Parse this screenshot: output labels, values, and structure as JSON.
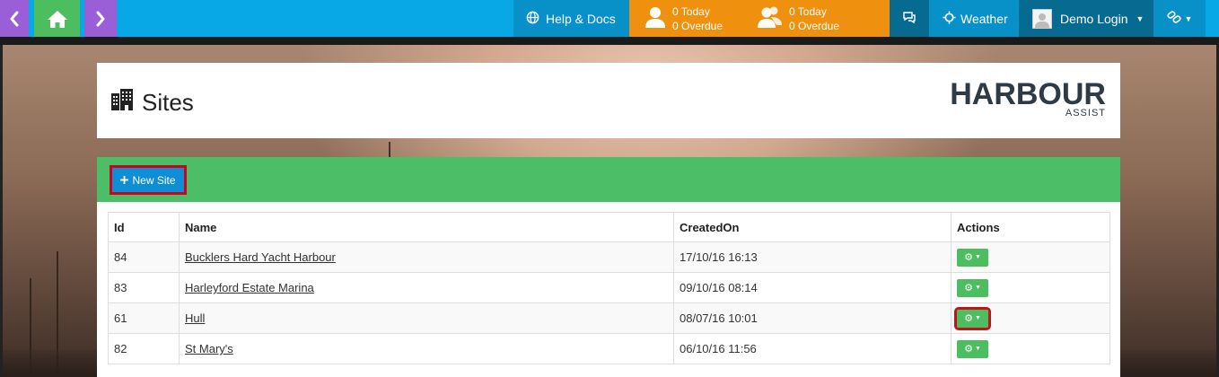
{
  "nav": {
    "back_icon": "chevron-left-icon",
    "home_icon": "home-icon",
    "forward_icon": "chevron-right-icon"
  },
  "topbar": {
    "help_label": "Help & Docs",
    "task_mine": {
      "today": "0 Today",
      "overdue": "0 Overdue"
    },
    "task_team": {
      "today": "0 Today",
      "overdue": "0 Overdue"
    },
    "weather_label": "Weather",
    "user_label": "Demo Login"
  },
  "header": {
    "title": "Sites",
    "logo_word": "HARBOUR",
    "logo_sub": "ASSIST"
  },
  "toolbar": {
    "new_site_label": "New Site"
  },
  "table": {
    "columns": [
      "Id",
      "Name",
      "CreatedOn",
      "Actions"
    ],
    "rows": [
      {
        "id": "84",
        "name": "Bucklers Hard Yacht Harbour",
        "created": "17/10/16 16:13"
      },
      {
        "id": "83",
        "name": "Harleyford Estate Marina",
        "created": "09/10/16 08:14"
      },
      {
        "id": "61",
        "name": "Hull",
        "created": "08/07/16 10:01"
      },
      {
        "id": "82",
        "name": "St Mary's",
        "created": "06/10/16 11:56"
      }
    ]
  },
  "colors": {
    "topbar": "#08a8e6",
    "nav_purple": "#9a5fd6",
    "nav_green": "#4cbe5f",
    "tasks_orange": "#f0900f",
    "toolbar_green": "#4cbe68",
    "highlight_red": "#d0021b",
    "button_blue": "#0e8ed6"
  }
}
